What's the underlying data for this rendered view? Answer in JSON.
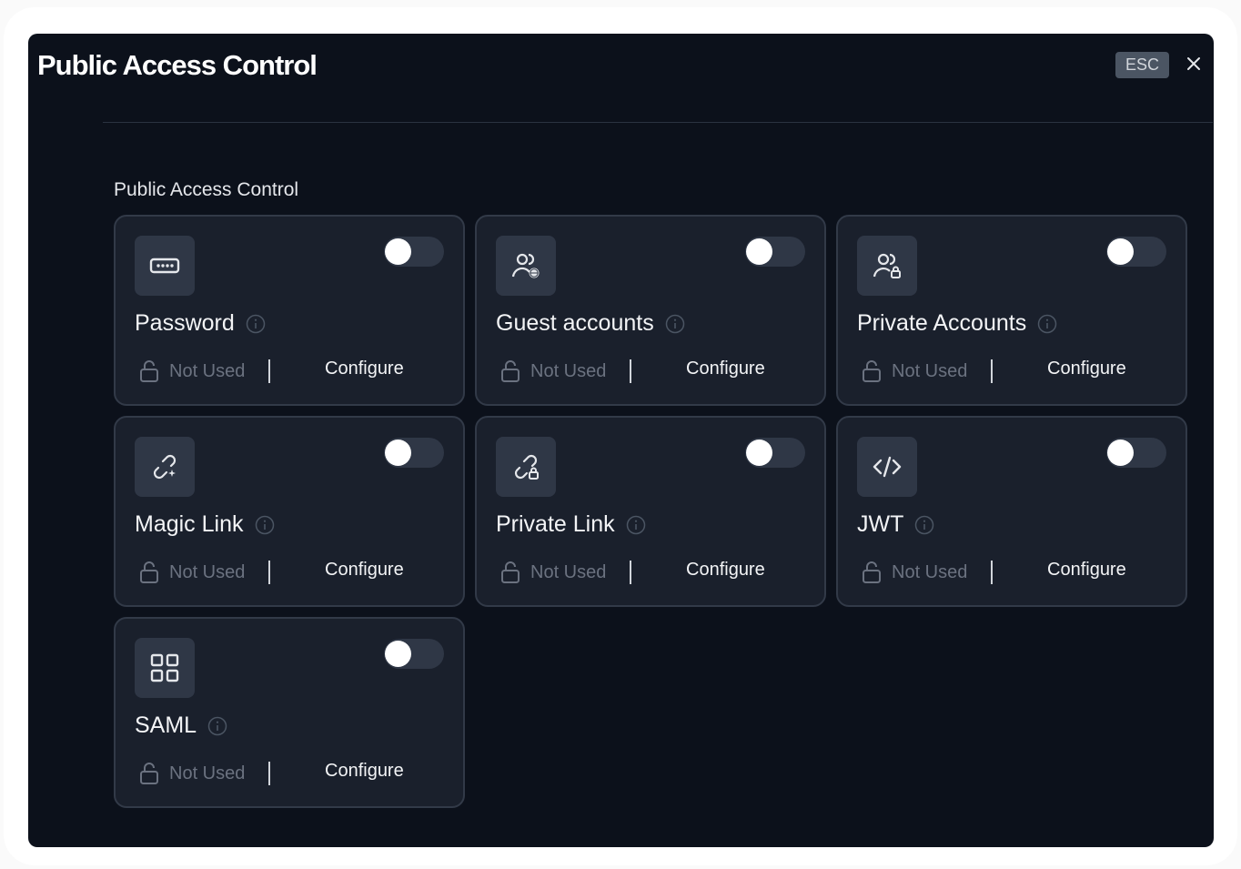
{
  "modal": {
    "title": "Public Access Control",
    "esc_label": "ESC",
    "close_icon": "close-icon"
  },
  "section": {
    "label": "Public Access Control"
  },
  "cards": [
    {
      "title": "Password",
      "icon": "password-icon",
      "status": "Not Used",
      "action": "Configure",
      "enabled": false
    },
    {
      "title": "Guest accounts",
      "icon": "user-globe-icon",
      "status": "Not Used",
      "action": "Configure",
      "enabled": false
    },
    {
      "title": "Private Accounts",
      "icon": "user-lock-icon",
      "status": "Not Used",
      "action": "Configure",
      "enabled": false
    },
    {
      "title": "Magic Link",
      "icon": "link-sparkle-icon",
      "status": "Not Used",
      "action": "Configure",
      "enabled": false
    },
    {
      "title": "Private Link",
      "icon": "link-lock-icon",
      "status": "Not Used",
      "action": "Configure",
      "enabled": false
    },
    {
      "title": "JWT",
      "icon": "code-icon",
      "status": "Not Used",
      "action": "Configure",
      "enabled": false
    },
    {
      "title": "SAML",
      "icon": "grid-icon",
      "status": "Not Used",
      "action": "Configure",
      "enabled": false
    }
  ],
  "colors": {
    "modal_bg": "#0c111b",
    "card_bg": "#1a202c",
    "card_border": "#323a48",
    "toggle_off_bg": "#2f3746",
    "muted_text": "#6b7280"
  }
}
